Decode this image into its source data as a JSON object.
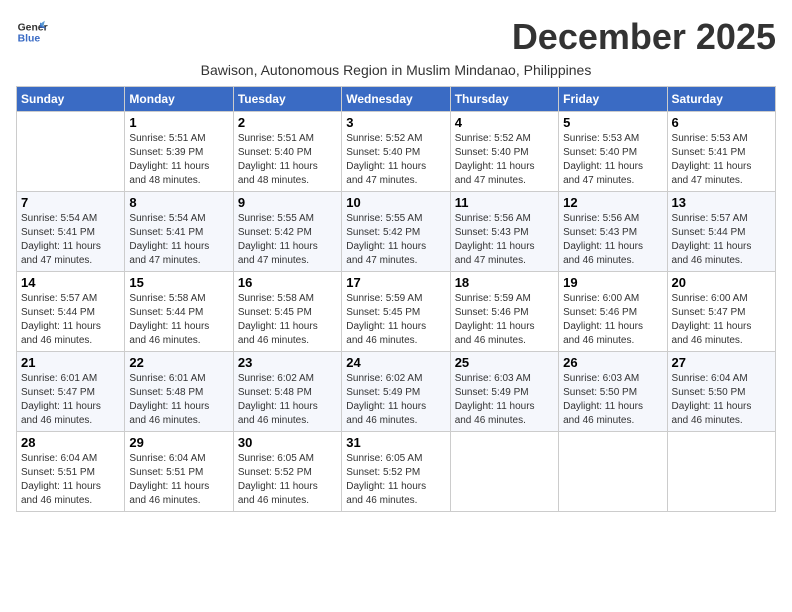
{
  "header": {
    "logo_line1": "General",
    "logo_line2": "Blue",
    "month_title": "December 2025",
    "subtitle": "Bawison, Autonomous Region in Muslim Mindanao, Philippines"
  },
  "columns": [
    "Sunday",
    "Monday",
    "Tuesday",
    "Wednesday",
    "Thursday",
    "Friday",
    "Saturday"
  ],
  "weeks": [
    [
      {
        "num": "",
        "detail": ""
      },
      {
        "num": "1",
        "detail": "Sunrise: 5:51 AM\nSunset: 5:39 PM\nDaylight: 11 hours\nand 48 minutes."
      },
      {
        "num": "2",
        "detail": "Sunrise: 5:51 AM\nSunset: 5:40 PM\nDaylight: 11 hours\nand 48 minutes."
      },
      {
        "num": "3",
        "detail": "Sunrise: 5:52 AM\nSunset: 5:40 PM\nDaylight: 11 hours\nand 47 minutes."
      },
      {
        "num": "4",
        "detail": "Sunrise: 5:52 AM\nSunset: 5:40 PM\nDaylight: 11 hours\nand 47 minutes."
      },
      {
        "num": "5",
        "detail": "Sunrise: 5:53 AM\nSunset: 5:40 PM\nDaylight: 11 hours\nand 47 minutes."
      },
      {
        "num": "6",
        "detail": "Sunrise: 5:53 AM\nSunset: 5:41 PM\nDaylight: 11 hours\nand 47 minutes."
      }
    ],
    [
      {
        "num": "7",
        "detail": "Sunrise: 5:54 AM\nSunset: 5:41 PM\nDaylight: 11 hours\nand 47 minutes."
      },
      {
        "num": "8",
        "detail": "Sunrise: 5:54 AM\nSunset: 5:41 PM\nDaylight: 11 hours\nand 47 minutes."
      },
      {
        "num": "9",
        "detail": "Sunrise: 5:55 AM\nSunset: 5:42 PM\nDaylight: 11 hours\nand 47 minutes."
      },
      {
        "num": "10",
        "detail": "Sunrise: 5:55 AM\nSunset: 5:42 PM\nDaylight: 11 hours\nand 47 minutes."
      },
      {
        "num": "11",
        "detail": "Sunrise: 5:56 AM\nSunset: 5:43 PM\nDaylight: 11 hours\nand 47 minutes."
      },
      {
        "num": "12",
        "detail": "Sunrise: 5:56 AM\nSunset: 5:43 PM\nDaylight: 11 hours\nand 46 minutes."
      },
      {
        "num": "13",
        "detail": "Sunrise: 5:57 AM\nSunset: 5:44 PM\nDaylight: 11 hours\nand 46 minutes."
      }
    ],
    [
      {
        "num": "14",
        "detail": "Sunrise: 5:57 AM\nSunset: 5:44 PM\nDaylight: 11 hours\nand 46 minutes."
      },
      {
        "num": "15",
        "detail": "Sunrise: 5:58 AM\nSunset: 5:44 PM\nDaylight: 11 hours\nand 46 minutes."
      },
      {
        "num": "16",
        "detail": "Sunrise: 5:58 AM\nSunset: 5:45 PM\nDaylight: 11 hours\nand 46 minutes."
      },
      {
        "num": "17",
        "detail": "Sunrise: 5:59 AM\nSunset: 5:45 PM\nDaylight: 11 hours\nand 46 minutes."
      },
      {
        "num": "18",
        "detail": "Sunrise: 5:59 AM\nSunset: 5:46 PM\nDaylight: 11 hours\nand 46 minutes."
      },
      {
        "num": "19",
        "detail": "Sunrise: 6:00 AM\nSunset: 5:46 PM\nDaylight: 11 hours\nand 46 minutes."
      },
      {
        "num": "20",
        "detail": "Sunrise: 6:00 AM\nSunset: 5:47 PM\nDaylight: 11 hours\nand 46 minutes."
      }
    ],
    [
      {
        "num": "21",
        "detail": "Sunrise: 6:01 AM\nSunset: 5:47 PM\nDaylight: 11 hours\nand 46 minutes."
      },
      {
        "num": "22",
        "detail": "Sunrise: 6:01 AM\nSunset: 5:48 PM\nDaylight: 11 hours\nand 46 minutes."
      },
      {
        "num": "23",
        "detail": "Sunrise: 6:02 AM\nSunset: 5:48 PM\nDaylight: 11 hours\nand 46 minutes."
      },
      {
        "num": "24",
        "detail": "Sunrise: 6:02 AM\nSunset: 5:49 PM\nDaylight: 11 hours\nand 46 minutes."
      },
      {
        "num": "25",
        "detail": "Sunrise: 6:03 AM\nSunset: 5:49 PM\nDaylight: 11 hours\nand 46 minutes."
      },
      {
        "num": "26",
        "detail": "Sunrise: 6:03 AM\nSunset: 5:50 PM\nDaylight: 11 hours\nand 46 minutes."
      },
      {
        "num": "27",
        "detail": "Sunrise: 6:04 AM\nSunset: 5:50 PM\nDaylight: 11 hours\nand 46 minutes."
      }
    ],
    [
      {
        "num": "28",
        "detail": "Sunrise: 6:04 AM\nSunset: 5:51 PM\nDaylight: 11 hours\nand 46 minutes."
      },
      {
        "num": "29",
        "detail": "Sunrise: 6:04 AM\nSunset: 5:51 PM\nDaylight: 11 hours\nand 46 minutes."
      },
      {
        "num": "30",
        "detail": "Sunrise: 6:05 AM\nSunset: 5:52 PM\nDaylight: 11 hours\nand 46 minutes."
      },
      {
        "num": "31",
        "detail": "Sunrise: 6:05 AM\nSunset: 5:52 PM\nDaylight: 11 hours\nand 46 minutes."
      },
      {
        "num": "",
        "detail": ""
      },
      {
        "num": "",
        "detail": ""
      },
      {
        "num": "",
        "detail": ""
      }
    ]
  ]
}
